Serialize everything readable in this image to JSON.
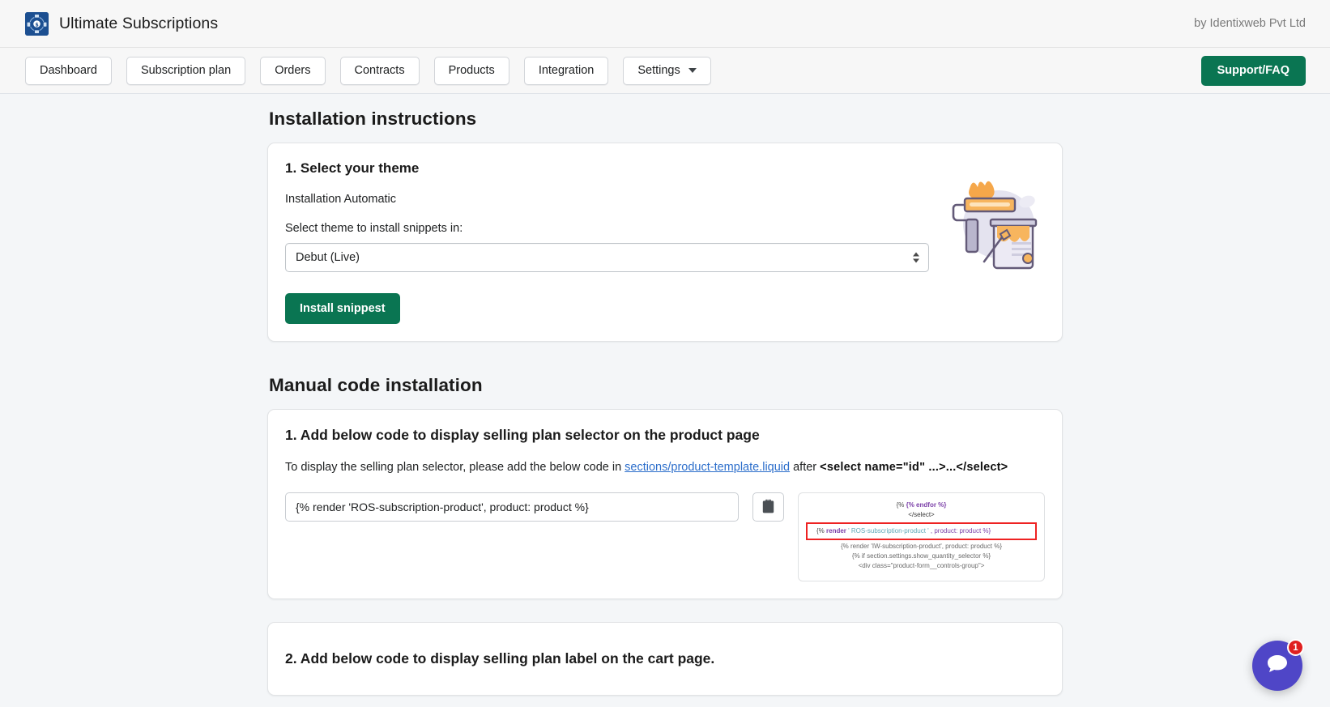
{
  "header": {
    "app_title": "Ultimate Subscriptions",
    "logo_icon": "subscription-coin-icon",
    "byline": "by Identixweb Pvt Ltd"
  },
  "nav": {
    "items": [
      {
        "label": "Dashboard",
        "has_caret": false
      },
      {
        "label": "Subscription plan",
        "has_caret": false
      },
      {
        "label": "Orders",
        "has_caret": false
      },
      {
        "label": "Contracts",
        "has_caret": false
      },
      {
        "label": "Products",
        "has_caret": false
      },
      {
        "label": "Integration",
        "has_caret": false
      },
      {
        "label": "Settings",
        "has_caret": true
      }
    ],
    "support_label": "Support/FAQ",
    "support_color": "#0a7552"
  },
  "installation": {
    "section_title": "Installation instructions",
    "card_heading": "1. Select your theme",
    "mode_text": "Installation Automatic",
    "select_label": "Select theme to install snippets in:",
    "theme_selected": "Debut (Live)",
    "install_button": "Install snippest",
    "illustration_icon": "paint-roller-bucket-illustration"
  },
  "manual": {
    "section_title": "Manual code installation",
    "step1": {
      "heading": "1. Add below code to display selling plan selector on the product page",
      "desc_prefix": "To display the selling plan selector, please add the below code in ",
      "desc_link": "sections/product-template.liquid",
      "desc_mid": " after ",
      "desc_code": "<select name=\"id\" ...>...</select>",
      "code_value": "{% render 'ROS-subscription-product', product: product %}",
      "copy_icon": "clipboard-copy-icon",
      "preview": {
        "line1": "{% endfor %}",
        "line2": "</select>",
        "highlight_open": "{% ",
        "highlight_kw": "render",
        "highlight_str": " ' ROS-subscription-product ' ",
        "highlight_rest": ",  product: product %}",
        "line4": "{% render 'IW-subscription-product', product: product %}",
        "line5": "{% if section.settings.show_quantity_selector %}",
        "line6": "<div class=\"product-form__controls-group\">",
        "highlight_color": "#ee2222"
      }
    },
    "step2": {
      "heading": "2. Add below code to display selling plan label on the cart page."
    }
  },
  "chat": {
    "icon": "chat-bubble-icon",
    "badge_count": "1",
    "color": "#4f46c7",
    "badge_color": "#e02020"
  }
}
